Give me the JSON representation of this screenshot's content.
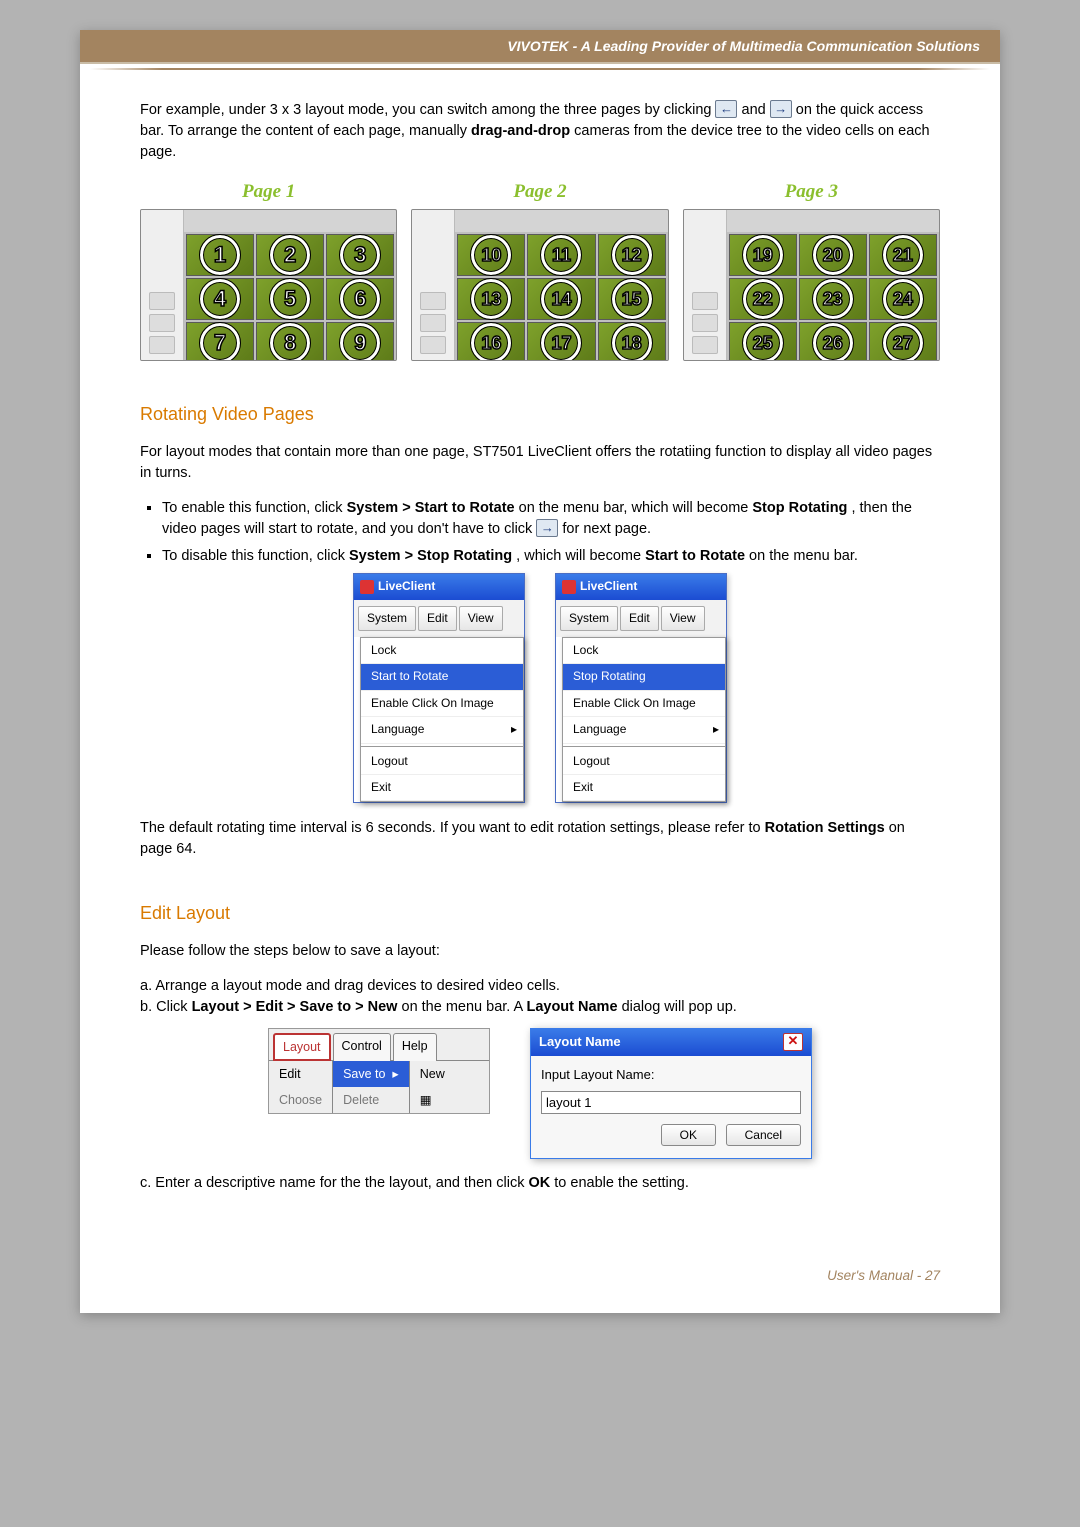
{
  "header": "VIVOTEK - A Leading Provider of Multimedia Communication Solutions",
  "intro": {
    "p1a": "For example, under 3 x 3 layout mode, you can switch among the three pages by clicking ",
    "p1b": " and ",
    "p1c": " on the quick access bar. To arrange the content of each page, manually ",
    "bold1": "drag-and-drop",
    "p1d": " cameras from the device tree to the video cells on each page."
  },
  "pages": [
    {
      "label": "Page 1",
      "cells": [
        "1",
        "2",
        "3",
        "4",
        "5",
        "6",
        "7",
        "8",
        "9"
      ]
    },
    {
      "label": "Page 2",
      "cells": [
        "10",
        "11",
        "12",
        "13",
        "14",
        "15",
        "16",
        "17",
        "18"
      ]
    },
    {
      "label": "Page 3",
      "cells": [
        "19",
        "20",
        "21",
        "22",
        "23",
        "24",
        "25",
        "26",
        "27"
      ]
    }
  ],
  "rotating": {
    "heading": "Rotating Video Pages",
    "p1": "For layout modes that contain more than one page, ST7501 LiveClient offers the rotatiing function to display all video pages in turns.",
    "b1a": "To enable this function, click ",
    "b1b": "System > Start to Rotate",
    "b1c": " on the menu bar, which will become ",
    "b1d": "Stop Rotating",
    "b1e": ", then the video pages will start to rotate, and you don't have to click ",
    "b1f": " for next page.",
    "b2a": "To disable this function, click ",
    "b2b": "System > Stop Rotating",
    "b2c": ", which will become ",
    "b2d": "Start to Rotate",
    "b2e": " on the menu bar.",
    "p2a": "The default rotating time interval is 6 seconds. If you want to edit rotation settings, please refer to ",
    "p2b": "Rotation Settings",
    "p2c": " on page 64."
  },
  "menus": {
    "title": "LiveClient",
    "bar": [
      "System",
      "Edit",
      "View"
    ],
    "left": {
      "items": [
        "Lock",
        "Start to Rotate",
        "Enable Click On Image",
        "Language",
        "Logout",
        "Exit"
      ],
      "highlight": 1,
      "hasSub": 3,
      "sepBefore": 4
    },
    "right": {
      "items": [
        "Lock",
        "Stop Rotating",
        "Enable Click On Image",
        "Language",
        "Logout",
        "Exit"
      ],
      "highlight": 1,
      "hasSub": 3,
      "sepBefore": 4
    }
  },
  "editLayout": {
    "heading": "Edit Layout",
    "intro": "Please follow the steps below to save a layout:",
    "a": "a. Arrange a layout mode and drag devices to desired video cells.",
    "b1": "b. Click ",
    "b2": "Layout > Edit > Save to > New",
    "b3": " on the menu bar. A ",
    "b4": "Layout Name",
    "b5": " dialog will pop up.",
    "menuTabs": [
      "Layout",
      "Control",
      "Help"
    ],
    "submenu": {
      "left": [
        "Edit",
        "Choose"
      ],
      "mid": [
        "Save to",
        "Delete"
      ],
      "right": [
        "New"
      ]
    },
    "dialog": {
      "title": "Layout Name",
      "label": "Input Layout Name:",
      "value": "layout 1",
      "ok": "OK",
      "cancel": "Cancel"
    },
    "c1": "c. Enter a descriptive name for the the layout, and then click ",
    "c2": "OK",
    "c3": " to enable the setting."
  },
  "footer": "User's Manual - 27"
}
